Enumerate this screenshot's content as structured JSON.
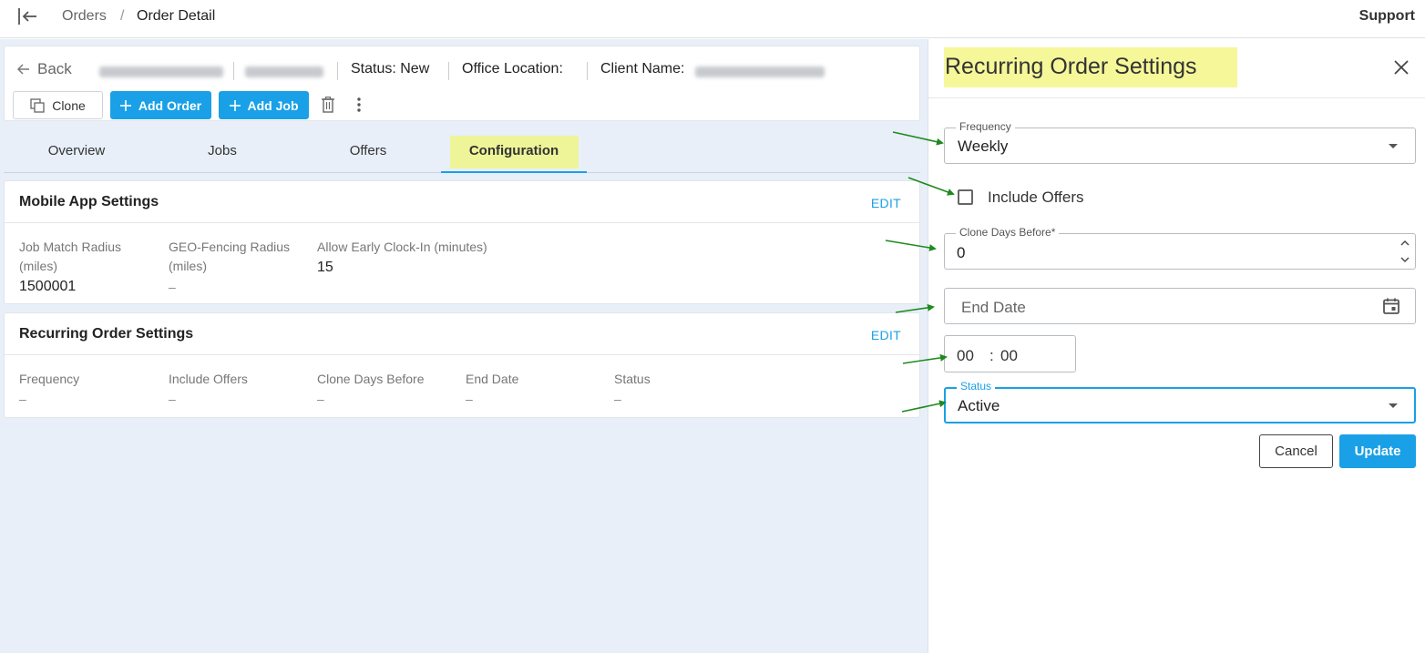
{
  "topbar": {
    "breadcrumb": {
      "orders": "Orders",
      "separator": "/",
      "current": "Order Detail"
    },
    "support": "Support"
  },
  "header": {
    "back": "Back",
    "status": "Status: New",
    "office_location": "Office Location:",
    "client_name": "Client Name:",
    "buttons": {
      "clone": "Clone",
      "add_order": "Add Order",
      "add_job": "Add Job"
    }
  },
  "tabs": [
    "Overview",
    "Jobs",
    "Offers",
    "Configuration"
  ],
  "active_tab": "Configuration",
  "mobile_settings": {
    "title": "Mobile App Settings",
    "edit": "EDIT",
    "fields": [
      {
        "label": "Job Match Radius (miles)",
        "value": "1500001"
      },
      {
        "label": "GEO-Fencing Radius (miles)",
        "value": "–"
      },
      {
        "label": "Allow Early Clock-In (minutes)",
        "value": "15"
      }
    ]
  },
  "recurring_settings": {
    "title": "Recurring Order Settings",
    "edit": "EDIT",
    "fields": [
      {
        "label": "Frequency",
        "value": "–"
      },
      {
        "label": "Include Offers",
        "value": "–"
      },
      {
        "label": "Clone Days Before",
        "value": "–"
      },
      {
        "label": "End Date",
        "value": "–"
      },
      {
        "label": "Status",
        "value": "–"
      }
    ]
  },
  "panel": {
    "title": "Recurring Order Settings",
    "frequency": {
      "label": "Frequency",
      "value": "Weekly"
    },
    "include_offers": {
      "label": "Include Offers",
      "checked": false
    },
    "clone_days_before": {
      "label": "Clone Days Before*",
      "value": "0"
    },
    "end_date": {
      "placeholder": "End Date"
    },
    "time": {
      "hours": "00",
      "separator": ":",
      "minutes": "00"
    },
    "status": {
      "label": "Status",
      "value": "Active"
    },
    "cancel": "Cancel",
    "update": "Update"
  },
  "colors": {
    "accent": "#1aa0e6",
    "highlight": "#f5f799",
    "arrow": "#1e8a1e",
    "background": "#e8eff8"
  }
}
